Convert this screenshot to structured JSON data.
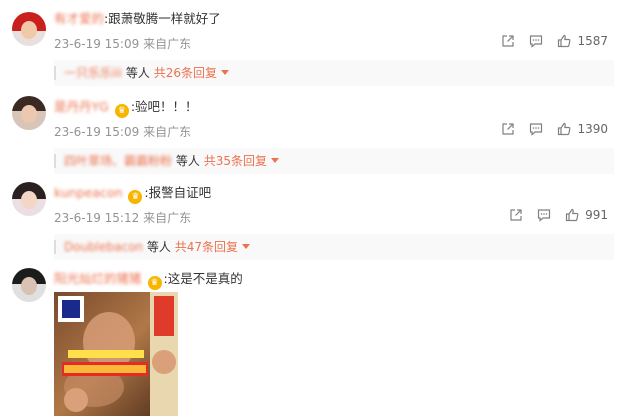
{
  "comments": [
    {
      "username": "有才爱的",
      "text": ":跟萧敬腾一样就好了",
      "time": "23-6-19 15:09",
      "location": "来自广东",
      "likes": "1587",
      "reply_names": "一只乐乐iii",
      "reply_deng": "等人",
      "reply_more": "共26条回复"
    },
    {
      "username": "是丹丹YG",
      "text": ":验吧！！！",
      "time": "23-6-19 15:09",
      "location": "来自广东",
      "likes": "1390",
      "reply_names": "四叶草场、霸霸粉粉",
      "reply_deng": "等人",
      "reply_more": "共35条回复"
    },
    {
      "username": "kunpeacon",
      "text": ":报警自证吧",
      "time": "23-6-19 15:12",
      "location": "来自广东",
      "likes": "991",
      "reply_names": "Doublebacon",
      "reply_deng": "等人",
      "reply_more": "共47条回复"
    },
    {
      "username": "阳光灿烂的猪猪",
      "text": ":这是不是真的"
    }
  ],
  "colors": {
    "accent": "#eb7350",
    "meta": "#939393",
    "text": "#333333"
  },
  "icons": {
    "share": "share-icon",
    "comment": "comment-icon",
    "like": "thumb-up-icon",
    "vip": "vip-crown-icon",
    "dropdown": "caret-down-icon"
  }
}
